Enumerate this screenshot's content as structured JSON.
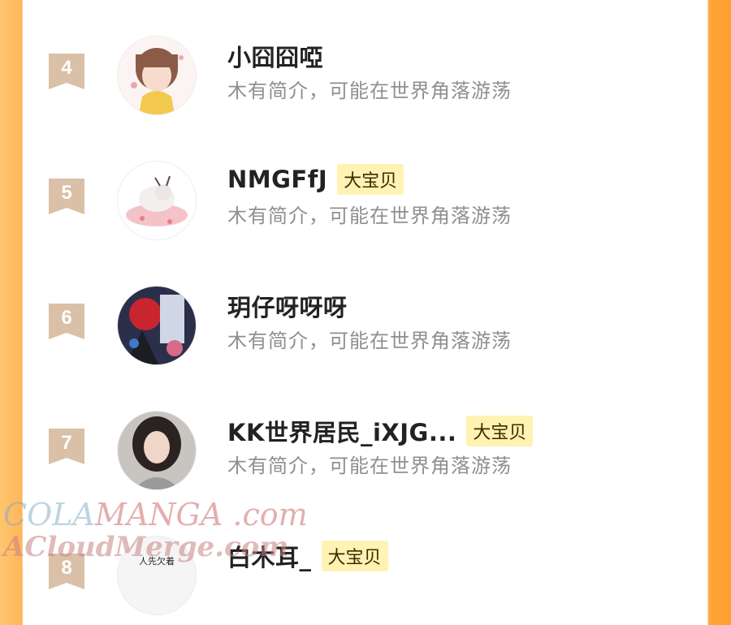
{
  "list": [
    {
      "rank": "4",
      "name": "小囧囧啞",
      "badge": "",
      "bio": "木有简介，可能在世界角落游荡"
    },
    {
      "rank": "5",
      "name": "NMGFfJ",
      "badge": "大宝贝",
      "bio": "木有简介，可能在世界角落游荡"
    },
    {
      "rank": "6",
      "name": "玥仔呀呀呀",
      "badge": "",
      "bio": "木有简介，可能在世界角落游荡"
    },
    {
      "rank": "7",
      "name": "KK世界居民_iXJG...",
      "badge": "大宝贝",
      "bio": "木有简介，可能在世界角落游荡"
    },
    {
      "rank": "8",
      "name": "白木耳_",
      "badge": "大宝贝",
      "bio": "",
      "avatar_caption": "人先欠着"
    }
  ],
  "watermark": {
    "line1_a": "COLA",
    "line1_b": "MANGA",
    "line1_c": ".com",
    "line2": "ACloudMerge.com"
  },
  "colors": {
    "rank_flag": "#d9c0a6",
    "badge_bg": "#fff2b3",
    "side_orange": "#ffa43a"
  }
}
